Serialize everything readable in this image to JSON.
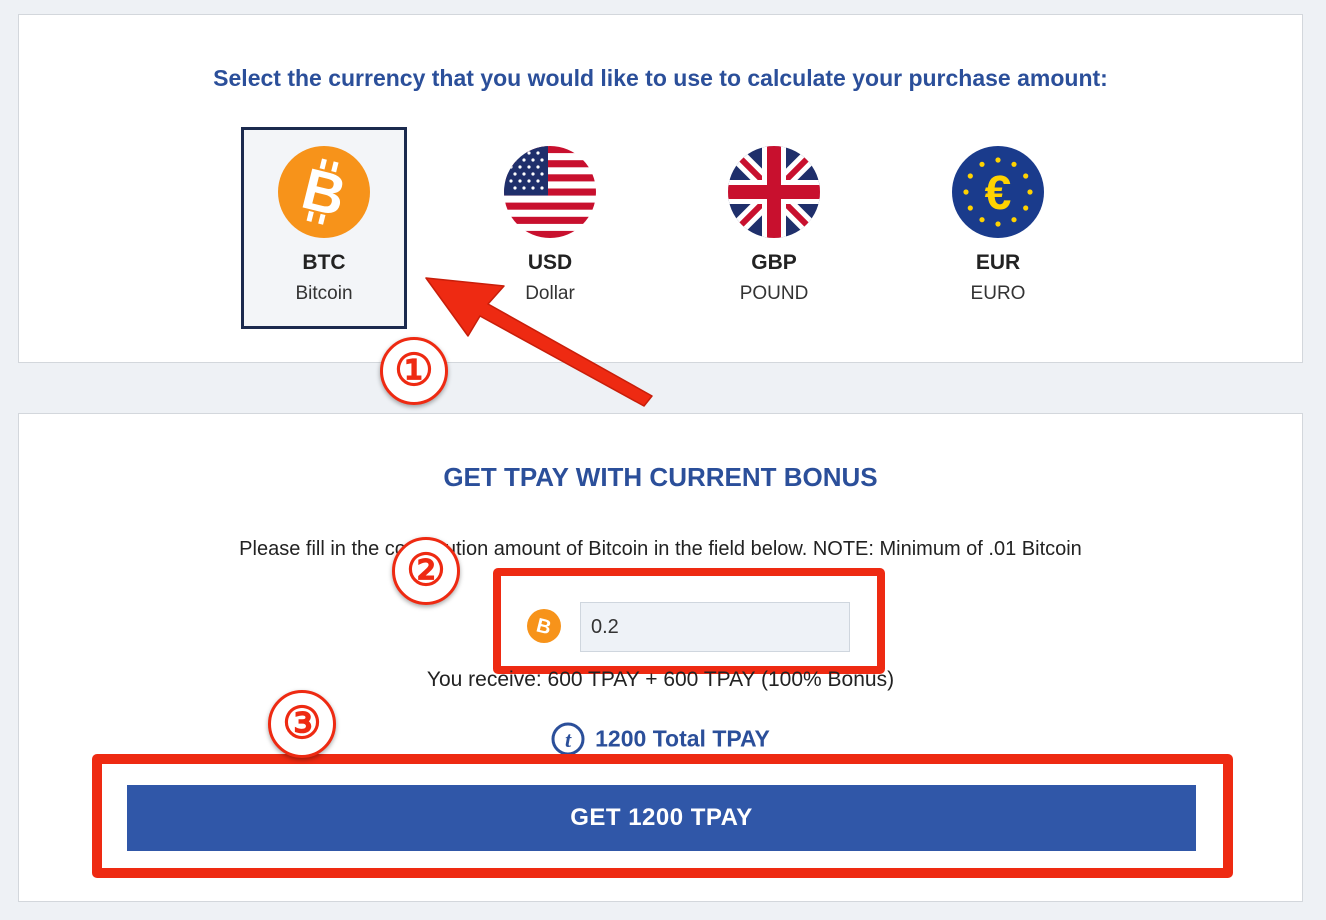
{
  "currency_section": {
    "heading": "Select the currency that you would like to use to calculate your purchase amount:",
    "selected": "BTC",
    "options": [
      {
        "code": "BTC",
        "name": "Bitcoin",
        "icon": "bitcoin-coin-icon",
        "color": "#f7931a"
      },
      {
        "code": "USD",
        "name": "Dollar",
        "icon": "us-flag-icon"
      },
      {
        "code": "GBP",
        "name": "POUND",
        "icon": "uk-flag-icon"
      },
      {
        "code": "EUR",
        "name": "EURO",
        "icon": "euro-icon",
        "color": "#1a3b8c"
      }
    ]
  },
  "bonus_section": {
    "heading": "GET TPAY WITH CURRENT BONUS",
    "instructions": "Please fill in the contribution amount of Bitcoin in the field below. NOTE: Minimum of .01 Bitcoin",
    "amount_value": "0.2",
    "receive_text": "You receive: 600 TPAY + 600 TPAY (100% Bonus)",
    "total_text": "1200 Total TPAY",
    "button_label": "GET 1200 TPAY"
  },
  "annotations": {
    "marker1": "①",
    "marker2": "②",
    "marker3": "③",
    "highlight_color": "#ee2a12"
  },
  "colors": {
    "accent_blue": "#2b4f9a",
    "button_blue": "#3057a8",
    "bitcoin_orange": "#f7931a"
  }
}
